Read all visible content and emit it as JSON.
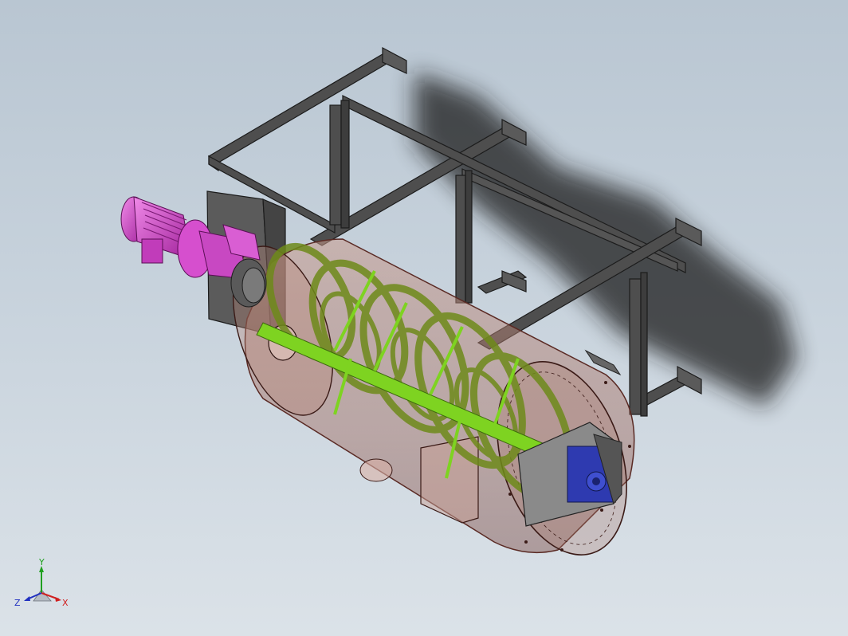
{
  "viewport": {
    "background_top": "#b9c6d2",
    "background_bottom": "#dbe2e8"
  },
  "model": {
    "frame_color": "#4a4a4a",
    "tank_color": "#a26a5c",
    "ribbon_color": "#6e8a1a",
    "shaft_color": "#7ed321",
    "motor_color": "#d94bd2",
    "gearbox_color": "#3340b8"
  },
  "triad": {
    "x_label": "X",
    "y_label": "Y",
    "z_label": "Z",
    "x_color": "#d02020",
    "y_color": "#20a020",
    "z_color": "#2030c0"
  }
}
